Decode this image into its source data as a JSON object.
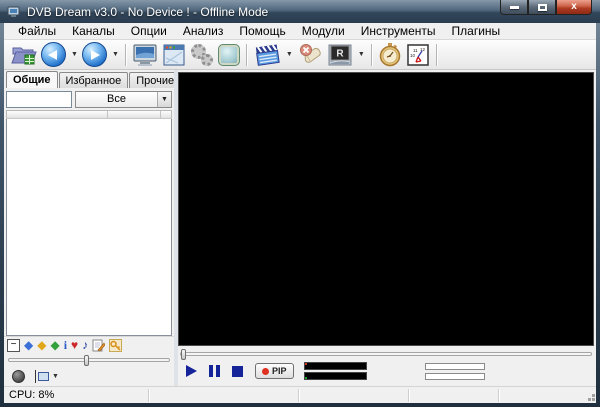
{
  "window": {
    "title": "DVB Dream v3.0 - No Device ! - Offline Mode"
  },
  "menu": {
    "items": [
      "Файлы",
      "Каналы",
      "Опции",
      "Анализ",
      "Помощь",
      "Модули",
      "Инструменты",
      "Плагины"
    ]
  },
  "toolbar": {
    "record_letter": "R",
    "icons": [
      "open-channel-list",
      "previous-channel",
      "next-channel",
      "fullscreen-monitor",
      "channel-window",
      "settings-gears",
      "skin-button",
      "video-clapper",
      "delete-eraser",
      "record",
      "stopwatch",
      "scheduler-clock"
    ]
  },
  "channel_panel": {
    "tabs": [
      {
        "label": "Общие",
        "active": true
      },
      {
        "label": "Избранное",
        "active": false
      },
      {
        "label": "Прочие",
        "active": false
      }
    ],
    "search_value": "",
    "filter_value": "Все",
    "filter_icons": [
      "collapse-minus",
      "diamond-blue",
      "diamond-gold",
      "diamond-green",
      "info",
      "favorite-heart",
      "audio-note",
      "edit-page",
      "key-scrambled"
    ]
  },
  "playback": {
    "pip_label": "PIP",
    "volume_percent": 47,
    "seek_percent": 0
  },
  "status_bar": {
    "cpu_label": "CPU: 8%"
  },
  "colors": {
    "frame": "#32465a",
    "close_button": "#ad3a22",
    "accent_blue": "#2273cc",
    "playback_blue": "#16249a",
    "video_bg": "#000000"
  }
}
